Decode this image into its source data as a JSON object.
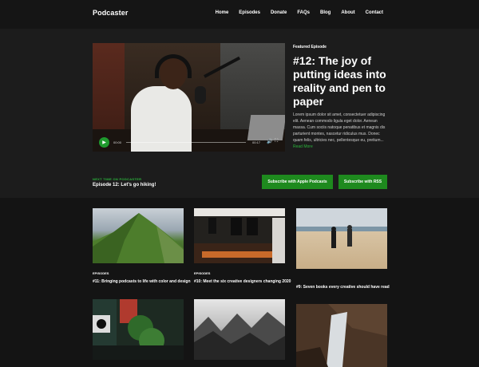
{
  "brand": {
    "name": "Podcaster"
  },
  "nav": [
    "Home",
    "Episodes",
    "Donate",
    "FAQs",
    "Blog",
    "About",
    "Contact"
  ],
  "hero": {
    "featured_label": "Featured Episode",
    "title": "#12: The joy of putting ideas into reality and pen to paper",
    "excerpt": "Lorem ipsum dolor sit amet, consectetuer adipiscing elit. Aenean commodo ligula eget dolor. Aenean massa. Cum sociis natoque penatibus et magnis dis parturient montes, nascetur ridiculus mus. Donec quam felis, ultricies nec, pellentesque eu, pretium...",
    "read_more": "Read More",
    "player": {
      "time_current": "00:00",
      "time_total": "00:17"
    }
  },
  "next": {
    "label": "NEXT TIME ON PODCASTER",
    "title": "Episode 12: Let's go hiking!",
    "apple_button": "Subscribe with Apple Podcasts",
    "rss_button": "Subscribe with RSS"
  },
  "cards": [
    {
      "category": "EPISODES",
      "title": "#11: Bringing podcasts to life with color and design"
    },
    {
      "category": "EPISODES",
      "title": "#10: Meet the six creative designers changing 2020"
    },
    {
      "category": "",
      "title": "#9: Seven books every creative should have read"
    },
    {
      "category": "",
      "title": ""
    },
    {
      "category": "",
      "title": ""
    },
    {
      "category": "",
      "title": ""
    }
  ]
}
